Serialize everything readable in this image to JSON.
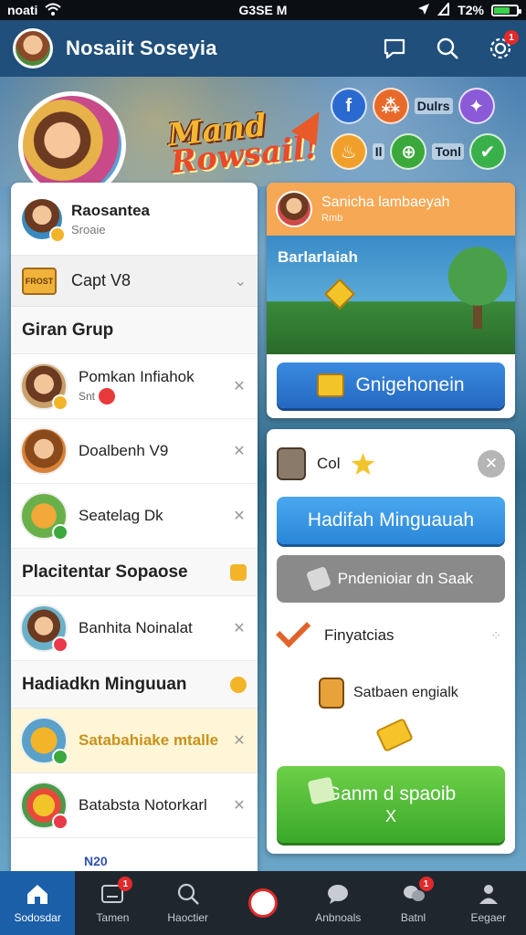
{
  "status_bar": {
    "carrier": "noati",
    "time": "G3SE M",
    "battery": "T2%",
    "battery_level": 0.72
  },
  "header": {
    "title": "Nosaiit Soseyia",
    "icons": [
      "chat-bubble-icon",
      "search-icon",
      "settings-gear-icon"
    ],
    "settings_badge": "1"
  },
  "banner": {
    "logo_line1": "Mand",
    "logo_line2": "Rowsail!",
    "social_row1_label": "Dulrs",
    "social_row2_number": "Il",
    "social_row2_label": "Tonl"
  },
  "left_panel": {
    "profile": {
      "name": "Raosantea",
      "sub": "Sroaie"
    },
    "capt": {
      "crate_text": "FROST",
      "label": "Capt V8"
    },
    "sections": {
      "giran": "Giran Grup",
      "placientar": "Placitentar Sopaose",
      "hadiadkn": "Hadiadkn Minguuan"
    },
    "items": [
      {
        "name": "Pomkan Infiahok",
        "sub": "Snt"
      },
      {
        "name": "Doalbenh V9"
      },
      {
        "name": "Seatelag Dk"
      },
      {
        "name": "Banhita Noinalat"
      },
      {
        "name": "Satabahiake mtalle"
      },
      {
        "name": "Batabsta Notorkarl"
      }
    ],
    "truncated_label": "N20"
  },
  "right_top_card": {
    "title": "Sanicha lambaeyah",
    "subtitle": "Rmb",
    "scene_label": "Barlarlaiah",
    "button_label": "Gnigehonein"
  },
  "right_bottom_card": {
    "header_label": "Col",
    "blue_button": "Hadifah Minguauah",
    "gray_button": "Pndenioiar dn Saak",
    "row_fin": "Finyatcias",
    "row_sab": "Satbaen engialk",
    "green_button_line1": "Ganm d spaoib",
    "green_button_line2": "X"
  },
  "bottom_nav": [
    {
      "label": "Sodosdar",
      "icon": "home-icon",
      "badge": ""
    },
    {
      "label": "Tamen",
      "icon": "inbox-icon",
      "badge": "1"
    },
    {
      "label": "Haoctier",
      "icon": "search-icon",
      "badge": ""
    },
    {
      "label": "",
      "icon": "center-action-icon",
      "badge": ""
    },
    {
      "label": "Anbnoals",
      "icon": "chat-icon",
      "badge": ""
    },
    {
      "label": "Batnl",
      "icon": "group-chat-icon",
      "badge": "1"
    },
    {
      "label": "Eegaer",
      "icon": "profile-icon",
      "badge": ""
    }
  ],
  "colors": {
    "header": "#1f4f7a",
    "nav_active": "#1a5fa8",
    "orange_head": "#f6a854",
    "blue_button": "#2a86d8",
    "green_button": "#3aa82a",
    "badge_red": "#e12a2a"
  }
}
